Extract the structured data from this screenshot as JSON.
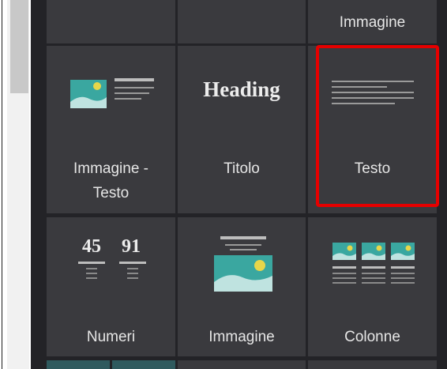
{
  "blocks": {
    "row0": {
      "image_label": "Immagine"
    },
    "image_text": {
      "label_line1": "Immagine -",
      "label_line2": "Testo"
    },
    "title": {
      "label": "Titolo",
      "preview_text": "Heading"
    },
    "text": {
      "label": "Testo"
    },
    "numbers": {
      "label": "Numeri",
      "value_a": "45",
      "value_b": "91"
    },
    "image": {
      "label": "Immagine"
    },
    "columns": {
      "label": "Colonne"
    }
  },
  "colors": {
    "panel_bg": "#232327",
    "tile_bg": "#3a3a3e",
    "highlight": "#e60000",
    "image_sky": "#3aa7a0",
    "image_sun": "#e7d64a"
  }
}
